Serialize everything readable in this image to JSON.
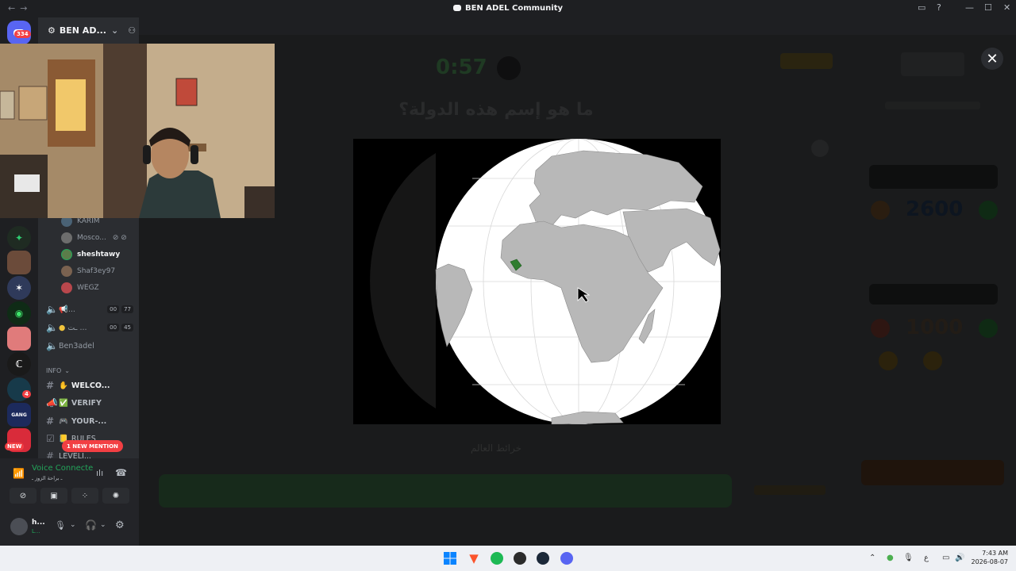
{
  "window": {
    "title": "BEN ADEL Community"
  },
  "server_bar": {
    "home_badge": "334",
    "badge_4": "4",
    "new_label": "NEW",
    "mention_label": "1 NEW MENTION"
  },
  "guild": {
    "name": "BEN AD..."
  },
  "voice_users": [
    {
      "name": "KARIM"
    },
    {
      "name": "Mosco..."
    },
    {
      "name": "sheshtawy"
    },
    {
      "name": "Shaf3ey97"
    },
    {
      "name": "WEGZ"
    }
  ],
  "voice_channels": [
    {
      "name": "...",
      "count_a": "00",
      "count_b": "77"
    },
    {
      "name": "ـت ...",
      "count_a": "00",
      "count_b": "45"
    },
    {
      "name": "Ben3adel"
    }
  ],
  "category": {
    "name": "INFO"
  },
  "text_channels": [
    {
      "name": "WELCO..."
    },
    {
      "name": "VERIFY"
    },
    {
      "name": "YOUR-..."
    },
    {
      "name": "RULES"
    },
    {
      "name": "LEVELI..."
    }
  ],
  "voice_panel": {
    "status": "Voice Connecte",
    "sub": "ـ براحة الزوز ـ"
  },
  "user_panel": {
    "name": "h...",
    "sub": "L..."
  },
  "quiz": {
    "timer": "0:57",
    "question": "ما هو إسم هذه الدولة؟",
    "caption": "خرائط العالم",
    "score_top": "2600",
    "score_bottom": "1000"
  },
  "taskbar": {
    "time": "7:43 AM",
    "date": "2026-08-07",
    "lang": "ع"
  },
  "colors": {
    "highlight_country": "#2f7d2f",
    "discord_green": "#23a55a",
    "mention_red": "#f23f43"
  }
}
